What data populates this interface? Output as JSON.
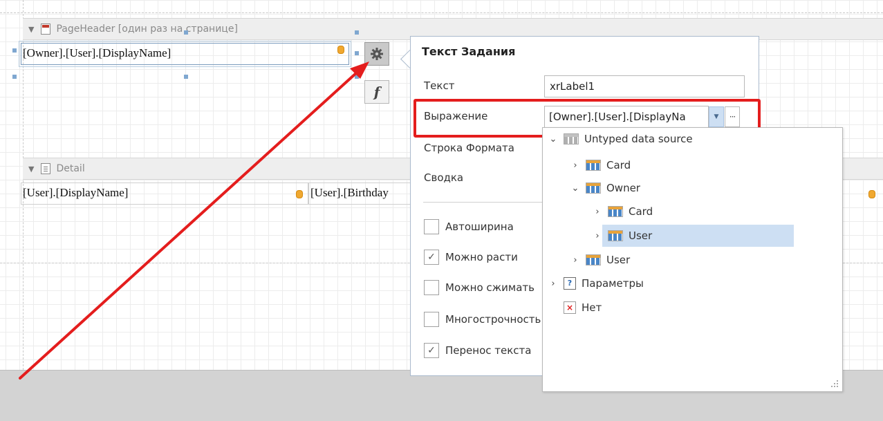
{
  "bands": {
    "page_header": {
      "label": "PageHeader [один раз на странице]"
    },
    "detail": {
      "label": "Detail"
    }
  },
  "labels": {
    "owner_display_name": "[Owner].[User].[DisplayName]",
    "user_display_name": "[User].[DisplayName]",
    "user_birthday": "[User].[Birthday"
  },
  "side_buttons": {
    "fx_text": "f"
  },
  "popup": {
    "title": "Текст Задания",
    "text_label": "Текст",
    "text_value": "xrLabel1",
    "expression_label": "Выражение",
    "expression_value": "[Owner].[User].[DisplayNa",
    "ellipsis": "···",
    "format_string_label": "Строка Формата",
    "summary_label": "Сводка",
    "checkboxes": [
      {
        "label": "Автоширина",
        "checked": false,
        "mark": ""
      },
      {
        "label": "Можно расти",
        "checked": true,
        "mark": "✓"
      },
      {
        "label": "Можно сжимать",
        "checked": false,
        "mark": ""
      },
      {
        "label": "Многострочность",
        "checked": false,
        "mark": ""
      },
      {
        "label": "Перенос текста",
        "checked": true,
        "mark": "✓"
      }
    ]
  },
  "tree": {
    "items": [
      {
        "label": "Untyped data source",
        "level": 0,
        "expanded": true,
        "icon": "table-grey-icon"
      },
      {
        "label": "Card",
        "level": 1,
        "expanded": false,
        "icon": "table-icon"
      },
      {
        "label": "Owner",
        "level": 1,
        "expanded": true,
        "icon": "table-icon"
      },
      {
        "label": "Card",
        "level": 2,
        "expanded": false,
        "icon": "table-icon"
      },
      {
        "label": "User",
        "level": 2,
        "expanded": false,
        "icon": "table-icon",
        "selected": true
      },
      {
        "label": "User",
        "level": 1,
        "expanded": false,
        "icon": "table-icon"
      },
      {
        "label": "Параметры",
        "level": 0,
        "expanded": false,
        "icon": "parameters-icon",
        "icon_text": "?"
      },
      {
        "label": "Нет",
        "level": 0,
        "icon": "none-icon",
        "icon_text": "×"
      }
    ]
  },
  "colors": {
    "highlight": "#e41d1d",
    "selection": "#cddff3",
    "database_icon": "#f0a830"
  }
}
